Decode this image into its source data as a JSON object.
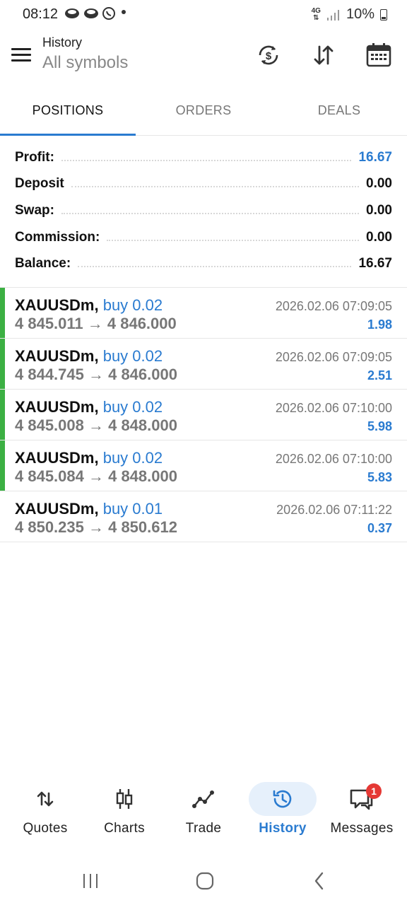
{
  "status_bar": {
    "time": "08:12",
    "network": "4G",
    "battery": "10%"
  },
  "app_bar": {
    "title": "History",
    "subtitle": "All symbols",
    "icons": [
      "menu-icon",
      "dollar-refresh-icon",
      "sort-icon",
      "calendar-icon"
    ]
  },
  "tabs": [
    {
      "label": "POSITIONS",
      "active": true
    },
    {
      "label": "ORDERS",
      "active": false
    },
    {
      "label": "DEALS",
      "active": false
    }
  ],
  "summary": {
    "profit": {
      "label": "Profit:",
      "value": "16.67"
    },
    "deposit": {
      "label": "Deposit",
      "value": "0.00"
    },
    "swap": {
      "label": "Swap:",
      "value": "0.00"
    },
    "commission": {
      "label": "Commission:",
      "value": "0.00"
    },
    "balance": {
      "label": "Balance:",
      "value": "16.67"
    }
  },
  "deals": [
    {
      "symbol": "XAUUSDm,",
      "side": "buy 0.02",
      "prices": "4 845.011 → 4 846.000",
      "time": "2026.02.06 07:09:05",
      "profit": "1.98",
      "marked": true
    },
    {
      "symbol": "XAUUSDm,",
      "side": "buy 0.02",
      "prices": "4 844.745 → 4 846.000",
      "time": "2026.02.06 07:09:05",
      "profit": "2.51",
      "marked": true
    },
    {
      "symbol": "XAUUSDm,",
      "side": "buy 0.02",
      "prices": "4 845.008 → 4 848.000",
      "time": "2026.02.06 07:10:00",
      "profit": "5.98",
      "marked": true
    },
    {
      "symbol": "XAUUSDm,",
      "side": "buy 0.02",
      "prices": "4 845.084 → 4 848.000",
      "time": "2026.02.06 07:10:00",
      "profit": "5.83",
      "marked": true
    },
    {
      "symbol": "XAUUSDm,",
      "side": "buy 0.01",
      "prices": "4 850.235 → 4 850.612",
      "time": "2026.02.06 07:11:22",
      "profit": "0.37",
      "marked": false
    }
  ],
  "bottom_nav": {
    "quotes": "Quotes",
    "charts": "Charts",
    "trade": "Trade",
    "history": "History",
    "messages": "Messages",
    "messages_badge": "1",
    "active": "History"
  },
  "colors": {
    "accent": "#2a7bd0",
    "position_marker": "#3cb043",
    "badge": "#e53935"
  }
}
